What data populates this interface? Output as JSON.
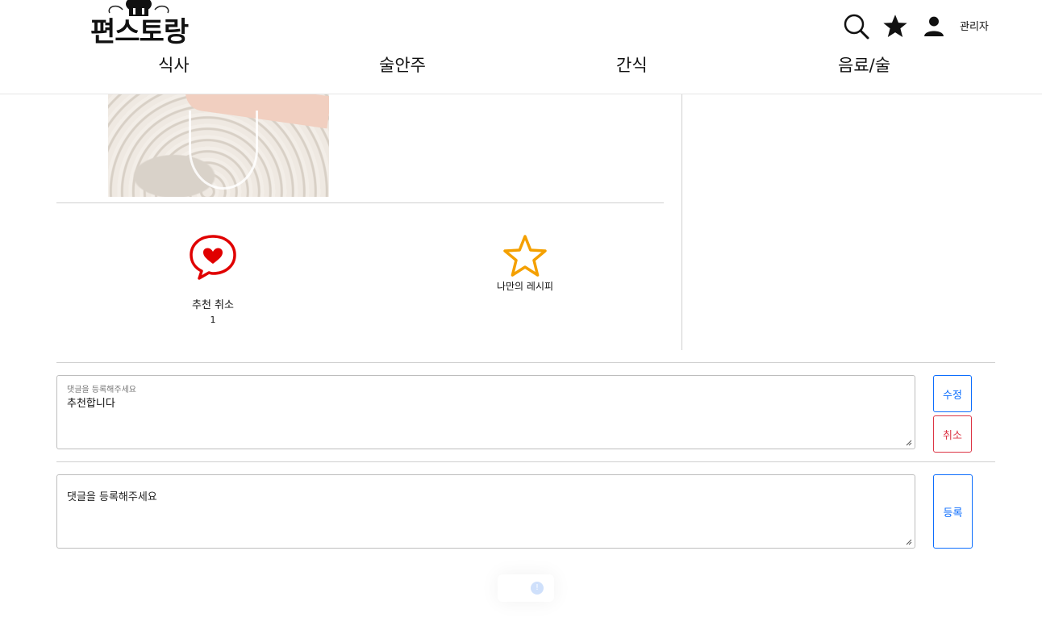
{
  "header": {
    "logo_text": "편스토랑",
    "nav": [
      "식사",
      "술안주",
      "간식",
      "음료/술"
    ],
    "admin_label": "관리자"
  },
  "actions": {
    "recommend_label": "추천 취소",
    "recommend_count": "1",
    "my_recipe_label": "나만의 레시피"
  },
  "comments": {
    "edit_box": {
      "floating_label": "댓글을 등록해주세요",
      "value": "추천합니다",
      "edit_button": "수정",
      "cancel_button": "취소"
    },
    "new_box": {
      "placeholder": "댓글을 등록해주세요",
      "submit_button": "등록"
    }
  },
  "colors": {
    "primary": "#0d6efd",
    "danger": "#dc3545",
    "heart": "#e00000",
    "star": "#f4a000"
  },
  "icons": [
    "search-icon",
    "star-icon",
    "user-icon",
    "heart-chat-icon",
    "star-outline-icon",
    "info-icon"
  ]
}
